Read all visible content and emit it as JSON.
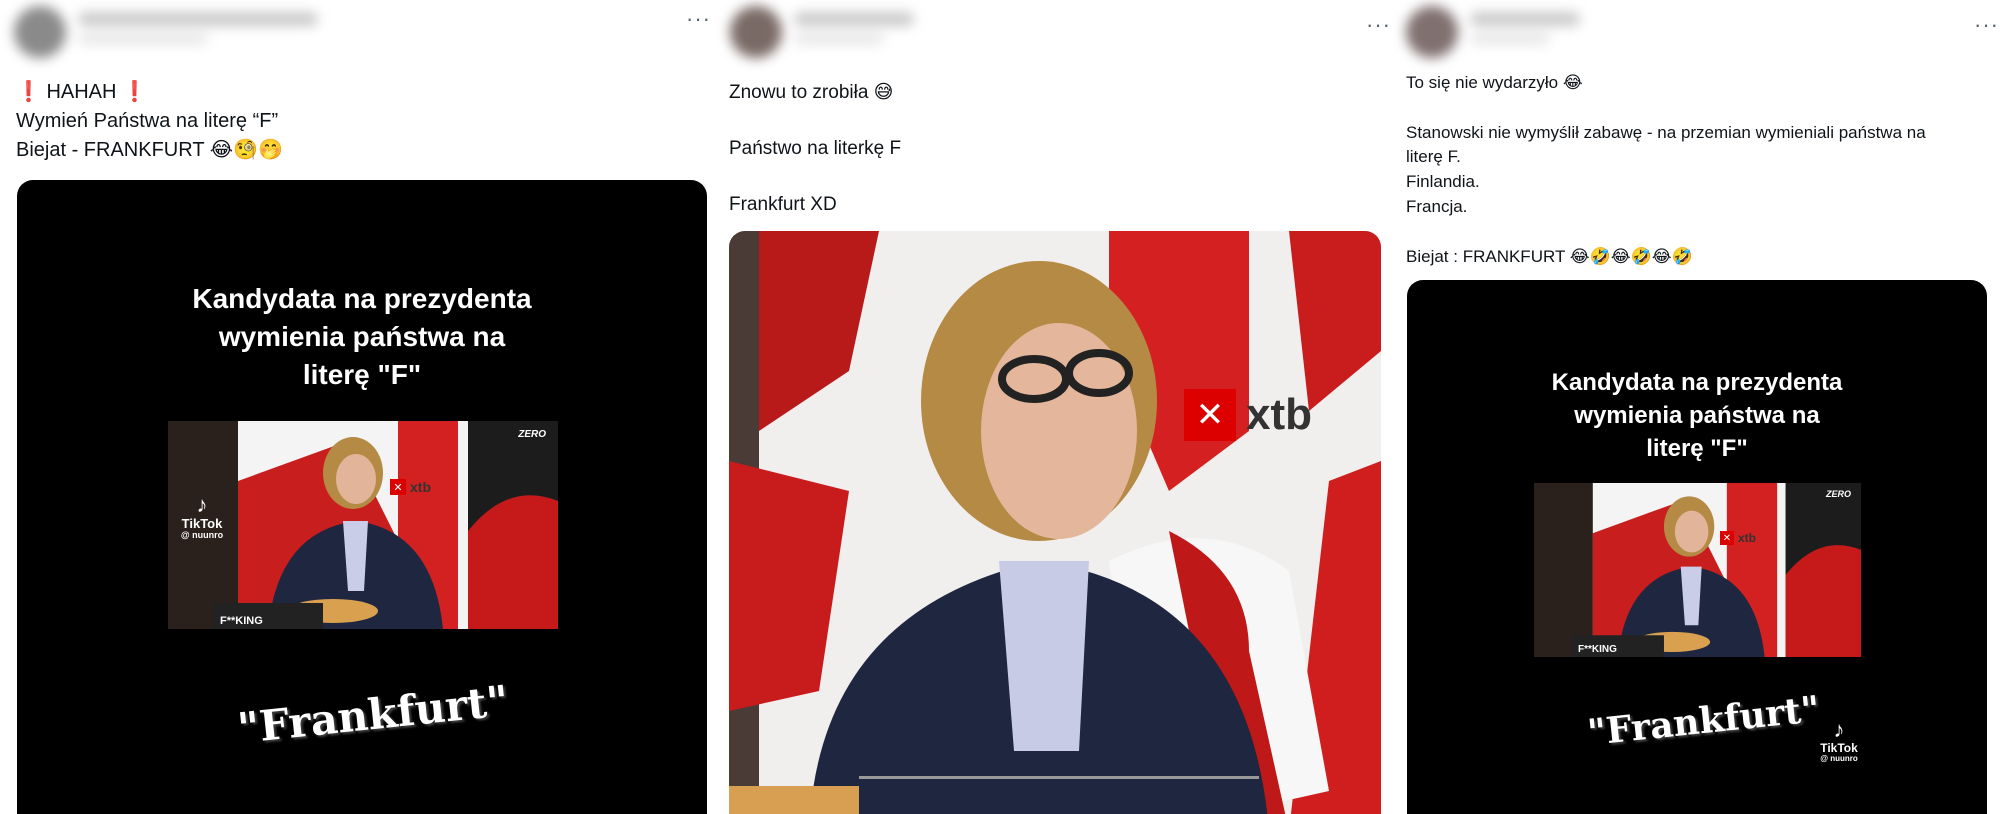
{
  "posts": [
    {
      "more_label": "···",
      "text_lines": [
        "❗ HAHAH ❗",
        "Wymień Państwa na literę “F”",
        "Biejat - FRANKFURT 😂🧐🤭"
      ],
      "video": {
        "caption_lines": [
          "Kandydata na prezydenta",
          "wymienia państwa na",
          "literę \"F\""
        ],
        "channel_logo": "ZERO",
        "brand": "xtb",
        "watermark": {
          "name": "TikTok",
          "handle": "@ nuunro"
        },
        "overlay_text": "F**KING",
        "quote": "\"Frankfurt\""
      }
    },
    {
      "more_label": "···",
      "text_lines": [
        "Znowu to zrobiła 😅",
        "",
        "Państwo na literkę F",
        "",
        "Frankfurt XD"
      ],
      "video": {
        "brand": "xtb"
      }
    },
    {
      "more_label": "···",
      "text_lines": [
        "To się nie wydarzyło 😂",
        "",
        "Stanowski nie wymyślił zabawę - na przemian wymieniali państwa na",
        "literę F.",
        "Finlandia.",
        "Francja.",
        "",
        "Biejat : FRANKFURT 😂🤣😂🤣😂🤣"
      ],
      "video": {
        "caption_lines": [
          "Kandydata na prezydenta",
          "wymienia państwa na",
          "literę \"F\""
        ],
        "channel_logo": "ZERO",
        "brand": "xtb",
        "watermark": {
          "name": "TikTok",
          "handle": "@ nuunro"
        },
        "overlay_text": "F**KING",
        "quote": "\"Frankfurt\""
      }
    }
  ]
}
